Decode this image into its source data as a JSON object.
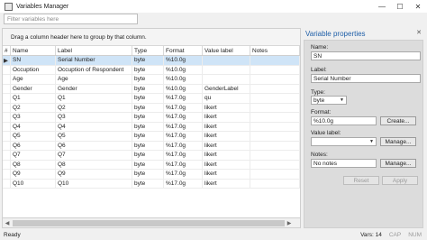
{
  "window": {
    "title": "Variables Manager",
    "minimize_glyph": "—",
    "maximize_glyph": "☐",
    "close_glyph": "✕"
  },
  "filter": {
    "placeholder": "Filter variables here"
  },
  "grid": {
    "group_hint": "Drag a column header here to group by that column.",
    "columns": [
      "#",
      "Name",
      "Label",
      "Type",
      "Format",
      "Value label",
      "Notes"
    ],
    "rows": [
      {
        "name": "SN",
        "label": "Serial Number",
        "type": "byte",
        "format": "%10.0g",
        "value_label": "",
        "notes": ""
      },
      {
        "name": "Occuption",
        "label": "Occuption of Respondent",
        "type": "byte",
        "format": "%10.0g",
        "value_label": "",
        "notes": ""
      },
      {
        "name": "Age",
        "label": "Age",
        "type": "byte",
        "format": "%10.0g",
        "value_label": "",
        "notes": ""
      },
      {
        "name": "Gender",
        "label": "Gender",
        "type": "byte",
        "format": "%10.0g",
        "value_label": "GenderLabel",
        "notes": ""
      },
      {
        "name": "Q1",
        "label": "Q1",
        "type": "byte",
        "format": "%17.0g",
        "value_label": "qu",
        "notes": ""
      },
      {
        "name": "Q2",
        "label": "Q2",
        "type": "byte",
        "format": "%17.0g",
        "value_label": "likert",
        "notes": ""
      },
      {
        "name": "Q3",
        "label": "Q3",
        "type": "byte",
        "format": "%17.0g",
        "value_label": "likert",
        "notes": ""
      },
      {
        "name": "Q4",
        "label": "Q4",
        "type": "byte",
        "format": "%17.0g",
        "value_label": "likert",
        "notes": ""
      },
      {
        "name": "Q5",
        "label": "Q5",
        "type": "byte",
        "format": "%17.0g",
        "value_label": "likert",
        "notes": ""
      },
      {
        "name": "Q6",
        "label": "Q6",
        "type": "byte",
        "format": "%17.0g",
        "value_label": "likert",
        "notes": ""
      },
      {
        "name": "Q7",
        "label": "Q7",
        "type": "byte",
        "format": "%17.0g",
        "value_label": "likert",
        "notes": ""
      },
      {
        "name": "Q8",
        "label": "Q8",
        "type": "byte",
        "format": "%17.0g",
        "value_label": "likert",
        "notes": ""
      },
      {
        "name": "Q9",
        "label": "Q9",
        "type": "byte",
        "format": "%17.0g",
        "value_label": "likert",
        "notes": ""
      },
      {
        "name": "Q10",
        "label": "Q10",
        "type": "byte",
        "format": "%17.0g",
        "value_label": "likert",
        "notes": ""
      }
    ]
  },
  "properties": {
    "title": "Variable properties",
    "pin_glyph": "✕",
    "name_label": "Name:",
    "name_value": "SN",
    "label_label": "Label:",
    "label_value": "Serial Number",
    "type_label": "Type:",
    "type_value": "byte",
    "format_label": "Format:",
    "format_value": "%10.0g",
    "create_button": "Create...",
    "value_label_label": "Value label:",
    "value_label_value": "",
    "manage_button": "Manage...",
    "notes_label": "Notes:",
    "notes_value": "No notes",
    "notes_manage_button": "Manage...",
    "reset_button": "Reset",
    "apply_button": "Apply"
  },
  "status": {
    "ready": "Ready",
    "vars": "Vars: 14",
    "cap": "CAP",
    "num": "NUM"
  }
}
